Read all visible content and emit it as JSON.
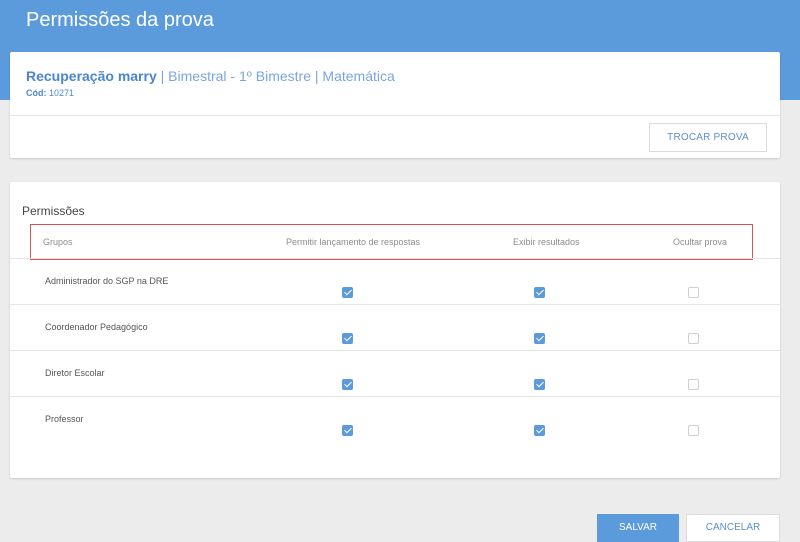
{
  "header": {
    "title": "Permissões da prova"
  },
  "exam": {
    "name": "Recuperação marry",
    "separator1": " | ",
    "period": "Bimestral - 1º Bimestre",
    "separator2": " | ",
    "subject": "Matemática",
    "code_label": "Cód:",
    "code_value": " 10271",
    "change_button": "TROCAR PROVA"
  },
  "permissions": {
    "title": "Permissões",
    "headers": {
      "groups": "Grupos",
      "allow_answers": "Permitir lançamento de respostas",
      "show_results": "Exibir resultados",
      "hide_exam": "Ocultar prova"
    },
    "rows": [
      {
        "group": "Administrador do SGP na DRE",
        "allow_answers": true,
        "show_results": true,
        "hide_exam": false
      },
      {
        "group": "Coordenador Pedagógico",
        "allow_answers": true,
        "show_results": true,
        "hide_exam": false
      },
      {
        "group": "Diretor Escolar",
        "allow_answers": true,
        "show_results": true,
        "hide_exam": false
      },
      {
        "group": "Professor",
        "allow_answers": true,
        "show_results": true,
        "hide_exam": false
      }
    ]
  },
  "footer": {
    "save_label": "SALVAR",
    "cancel_label": "CANCELAR"
  },
  "colors": {
    "primary": "#5b9bdc",
    "highlight_border": "#d9534f",
    "background": "#ececec"
  }
}
